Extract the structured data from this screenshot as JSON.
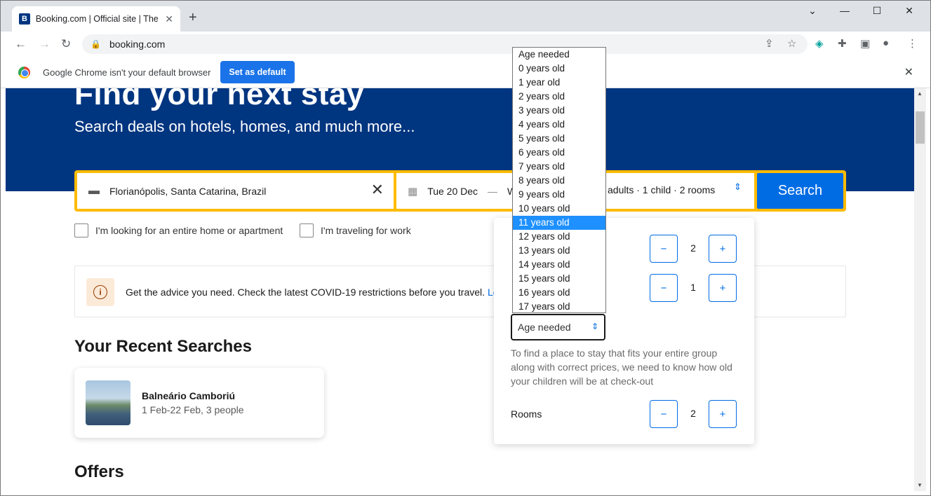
{
  "browser": {
    "tab_title": "Booking.com | Official site | The b",
    "favicon": "B",
    "url": "booking.com",
    "infobar_text": "Google Chrome isn't your default browser",
    "set_default_label": "Set as default"
  },
  "hero": {
    "title": "Find your next stay",
    "subtitle": "Search deals on hotels, homes, and much more..."
  },
  "search": {
    "destination": "Florianópolis, Santa Catarina, Brazil",
    "checkin": "Tue 20 Dec",
    "dash": "—",
    "checkout_partial": "W",
    "occupancy": "adults · 1 child · 2 rooms",
    "button": "Search"
  },
  "checks": {
    "entire_home": "I'm looking for an entire home or apartment",
    "work": "I'm traveling for work"
  },
  "covid": {
    "text": "Get the advice you need. Check the latest COVID-19 restrictions before you travel.",
    "link": "Lea"
  },
  "recent": {
    "title": "Your Recent Searches",
    "item_name": "Balneário Camboriú",
    "item_detail": "1 Feb-22 Feb, 3 people"
  },
  "offers": {
    "title": "Offers"
  },
  "popup": {
    "adults_value": "2",
    "children_value": "1",
    "rooms_label": "Rooms",
    "rooms_value": "2",
    "minus": "−",
    "plus": "+",
    "age_select_value": "Age needed",
    "age_help": "To find a place to stay that fits your entire group along with correct prices, we need to know how old your children will be at check-out"
  },
  "dropdown": {
    "options": [
      "Age needed",
      "0 years old",
      "1 year old",
      "2 years old",
      "3 years old",
      "4 years old",
      "5 years old",
      "6 years old",
      "7 years old",
      "8 years old",
      "9 years old",
      "10 years old",
      "11 years old",
      "12 years old",
      "13 years old",
      "14 years old",
      "15 years old",
      "16 years old",
      "17 years old"
    ],
    "selected": "11 years old"
  },
  "colors": {
    "brand_blue": "#003580",
    "action_blue": "#006ce4",
    "search_border": "#febb02",
    "highlight": "#1e90ff"
  }
}
